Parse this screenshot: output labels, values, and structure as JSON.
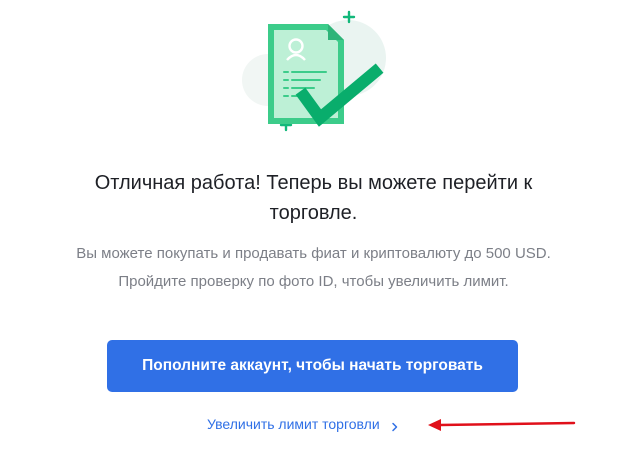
{
  "success": {
    "title_line1": "Отличная работа! Теперь вы можете перейти к",
    "title_line2": "торговле.",
    "description_line1": "Вы можете покупать и продавать фиат и криптовалюту до 500 USD.",
    "description_line2": "Пройдите проверку по фото ID, чтобы увеличить лимит."
  },
  "actions": {
    "deposit_button_label": "Пополните аккаунт, чтобы начать торговать",
    "increase_limit_link": "Увеличить лимит торговли"
  },
  "icons": {
    "illustration": "document-verified-icon",
    "link_chevron": "chevron-right-icon",
    "annotation": "red-arrow-icon"
  },
  "colors": {
    "accent": "#3070e6",
    "success": "#0bb16e",
    "annotation": "#e0101a"
  }
}
